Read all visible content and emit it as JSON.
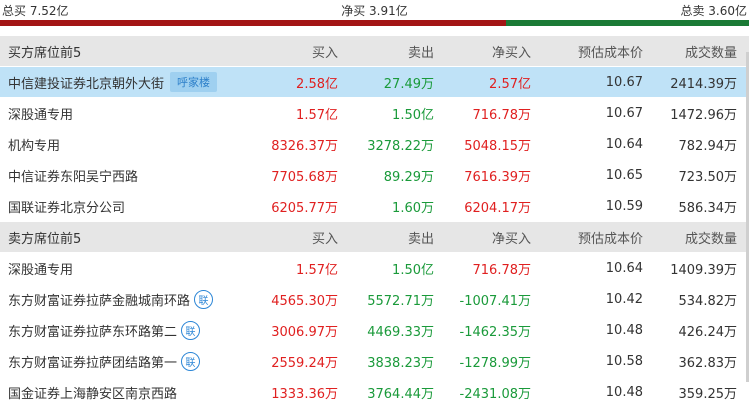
{
  "summary": {
    "total_buy": "总买 7.52亿",
    "net_buy": "净买 3.91亿",
    "total_sell": "总卖 3.60亿",
    "buy_share": 0.676,
    "colors": {
      "buy": "#a31515",
      "sell": "#1a7a35"
    }
  },
  "columns": [
    "买入",
    "卖出",
    "净买入",
    "预估成本价",
    "成交数量"
  ],
  "buy_section": {
    "title": "买方席位前5",
    "rows": [
      {
        "name": "中信建投证券北京朝外大街",
        "tag": "呼家楼",
        "buy": "2.58亿",
        "sell": "27.49万",
        "net": "2.57亿",
        "cost": "10.67",
        "volume": "2414.39万",
        "highlight": true
      },
      {
        "name": "深股通专用",
        "buy": "1.57亿",
        "sell": "1.50亿",
        "net": "716.78万",
        "cost": "10.67",
        "volume": "1472.96万"
      },
      {
        "name": "机构专用",
        "buy": "8326.37万",
        "sell": "3278.22万",
        "net": "5048.15万",
        "cost": "10.64",
        "volume": "782.94万"
      },
      {
        "name": "中信证券东阳吴宁西路",
        "buy": "7705.68万",
        "sell": "89.29万",
        "net": "7616.39万",
        "cost": "10.65",
        "volume": "723.50万"
      },
      {
        "name": "国联证券北京分公司",
        "buy": "6205.77万",
        "sell": "1.60万",
        "net": "6204.17万",
        "cost": "10.59",
        "volume": "586.34万"
      }
    ]
  },
  "sell_section": {
    "title": "卖方席位前5",
    "rows": [
      {
        "name": "深股通专用",
        "buy": "1.57亿",
        "sell": "1.50亿",
        "net": "716.78万",
        "cost": "10.64",
        "volume": "1409.39万"
      },
      {
        "name": "东方财富证券拉萨金融城南环路",
        "assoc": "联",
        "buy": "4565.30万",
        "sell": "5572.71万",
        "net": "-1007.41万",
        "cost": "10.42",
        "volume": "534.82万"
      },
      {
        "name": "东方财富证券拉萨东环路第二",
        "assoc": "联",
        "buy": "3006.97万",
        "sell": "4469.33万",
        "net": "-1462.35万",
        "cost": "10.48",
        "volume": "426.24万"
      },
      {
        "name": "东方财富证券拉萨团结路第一",
        "assoc": "联",
        "buy": "2559.24万",
        "sell": "3838.23万",
        "net": "-1278.99万",
        "cost": "10.58",
        "volume": "362.83万"
      },
      {
        "name": "国金证券上海静安区南京西路",
        "buy": "1333.36万",
        "sell": "3764.44万",
        "net": "-2431.08万",
        "cost": "10.48",
        "volume": "359.25万"
      }
    ]
  }
}
